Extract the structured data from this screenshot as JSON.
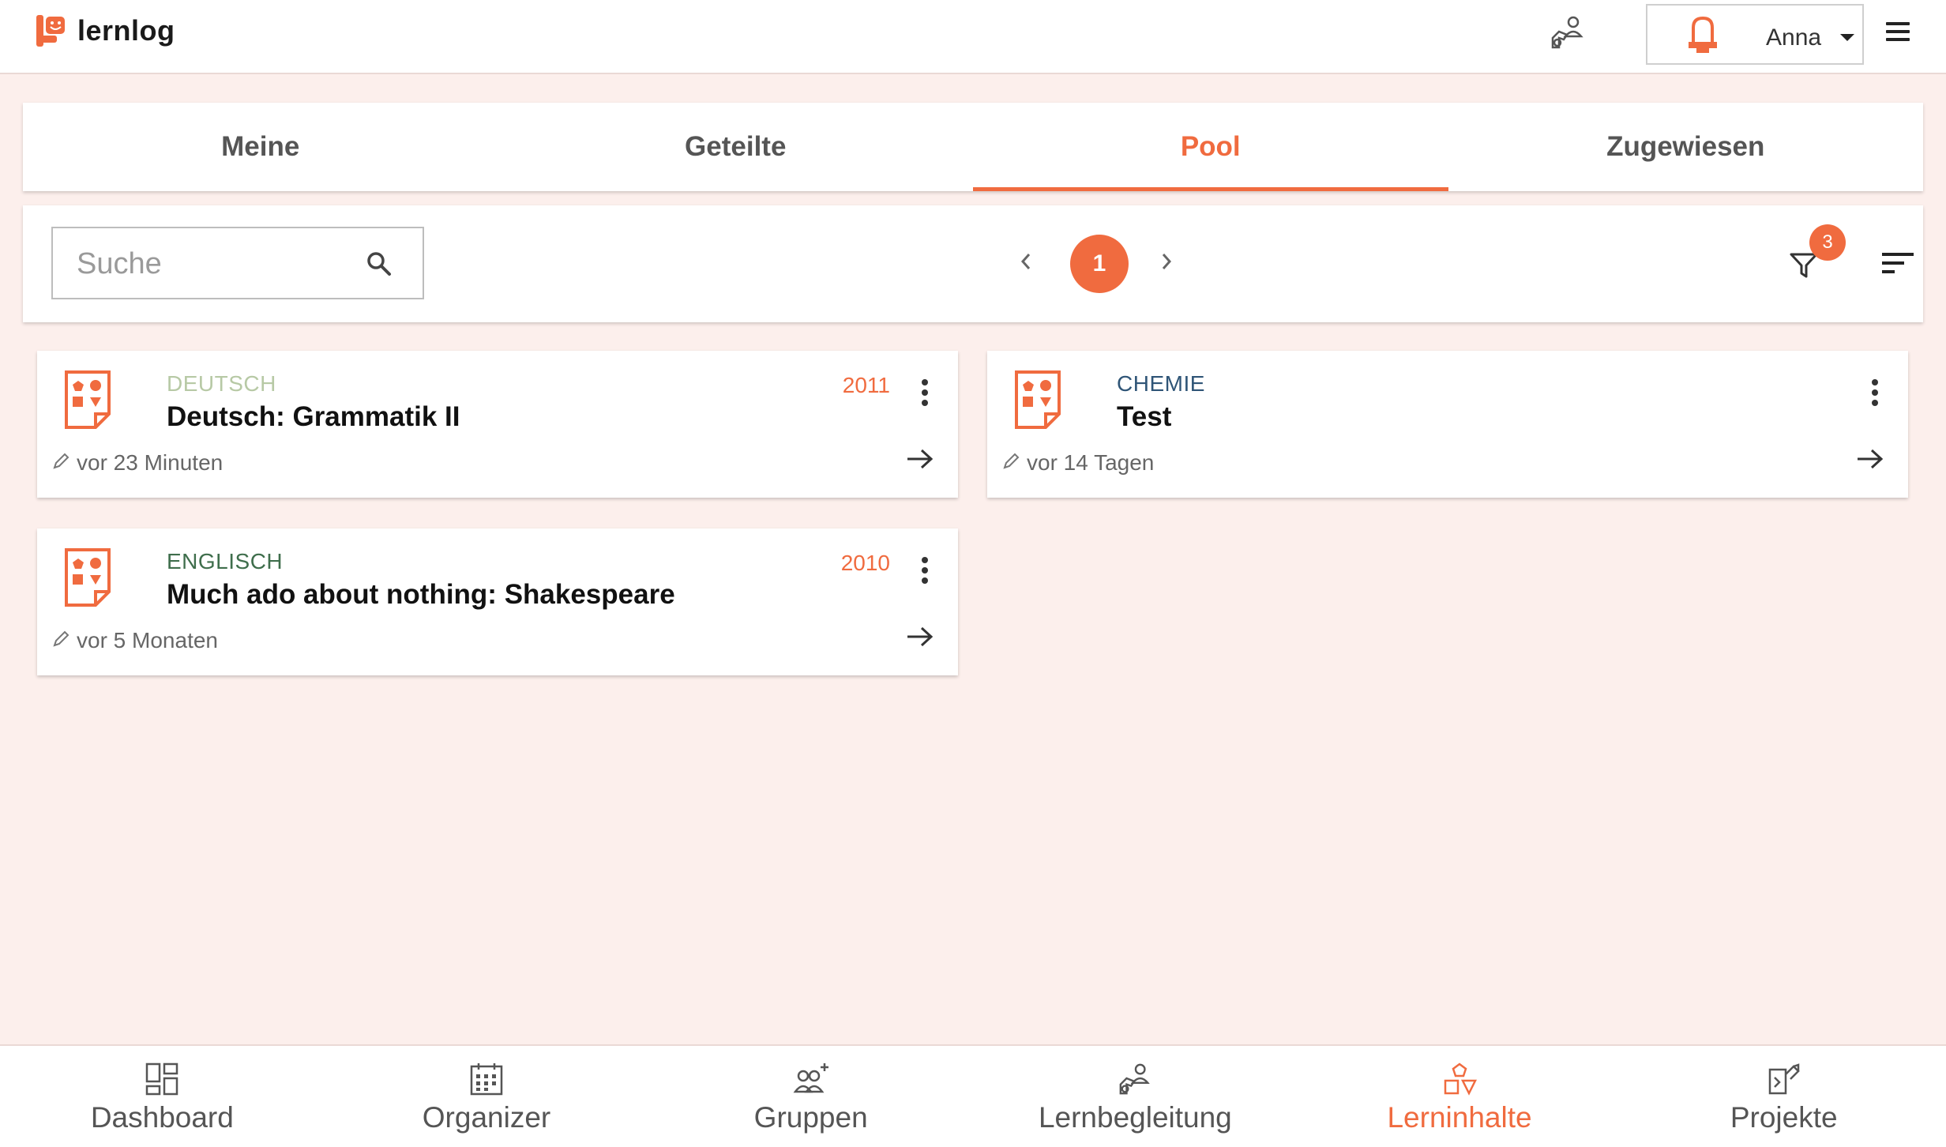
{
  "app": {
    "name": "lernlog",
    "accent": "#f06b3f"
  },
  "header": {
    "user_name": "Anna",
    "icons": [
      "lernbegleitung-icon",
      "user-avatar-icon",
      "menu-icon"
    ]
  },
  "tabs": [
    {
      "label": "Meine",
      "active": false
    },
    {
      "label": "Geteilte",
      "active": false
    },
    {
      "label": "Pool",
      "active": true
    },
    {
      "label": "Zugewiesen",
      "active": false
    }
  ],
  "toolbar": {
    "search_placeholder": "Suche",
    "search_value": "",
    "current_page": "1",
    "filter_count": "3"
  },
  "cards": [
    {
      "subject": "DEUTSCH",
      "subject_color": "#b7c9a5",
      "title": "Deutsch: Grammatik II",
      "year": "2011",
      "edited": "vor 23 Minuten"
    },
    {
      "subject": "CHEMIE",
      "subject_color": "#2f5577",
      "title": "Test",
      "year": "",
      "edited": "vor 14 Tagen"
    },
    {
      "subject": "ENGLISCH",
      "subject_color": "#3f6e4c",
      "title": "Much ado about nothing: Shakespeare",
      "year": "2010",
      "edited": "vor 5 Monaten"
    }
  ],
  "bottom_nav": [
    {
      "label": "Dashboard",
      "icon": "dashboard-icon",
      "active": false
    },
    {
      "label": "Organizer",
      "icon": "calendar-icon",
      "active": false
    },
    {
      "label": "Gruppen",
      "icon": "groups-icon",
      "active": false
    },
    {
      "label": "Lernbegleitung",
      "icon": "lernbegleitung-icon",
      "active": false
    },
    {
      "label": "Lerninhalte",
      "icon": "shapes-icon",
      "active": true
    },
    {
      "label": "Projekte",
      "icon": "projects-icon",
      "active": false
    }
  ]
}
